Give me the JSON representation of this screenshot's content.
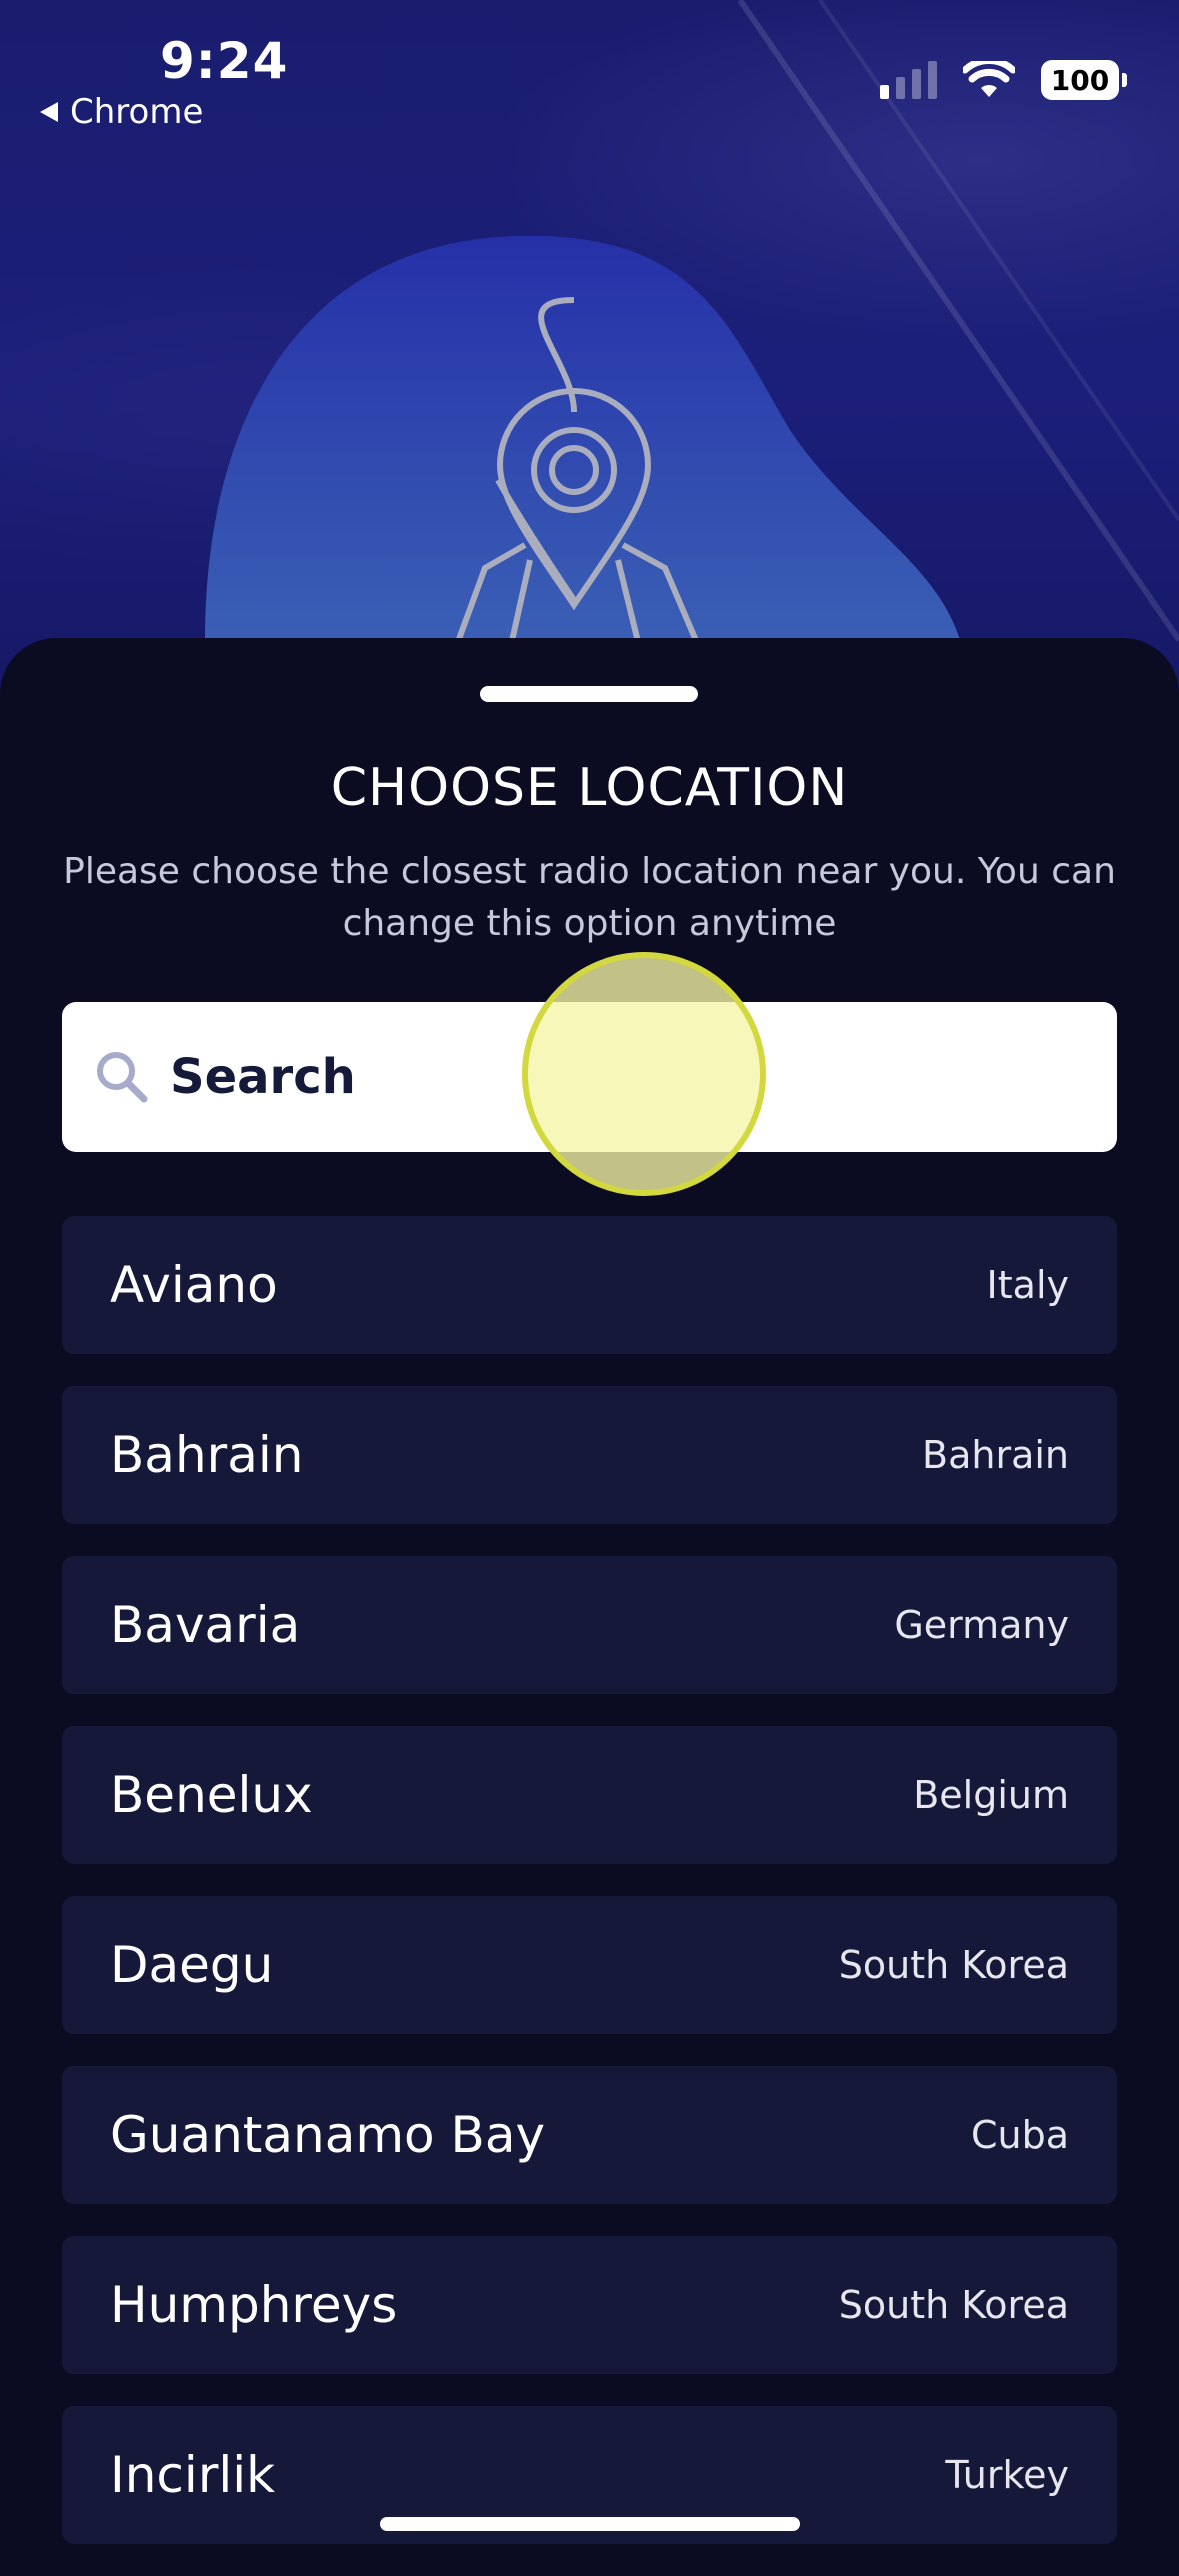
{
  "status_bar": {
    "time": "9:24",
    "back_label": "Chrome",
    "battery": "100"
  },
  "sheet": {
    "title": "CHOOSE LOCATION",
    "subtitle": "Please choose the closest radio location near you. You can change this option anytime",
    "search": {
      "placeholder": "Search",
      "value": ""
    }
  },
  "locations": [
    {
      "city": "Aviano",
      "country": "Italy"
    },
    {
      "city": "Bahrain",
      "country": "Bahrain"
    },
    {
      "city": "Bavaria",
      "country": "Germany"
    },
    {
      "city": "Benelux",
      "country": "Belgium"
    },
    {
      "city": "Daegu",
      "country": "South Korea"
    },
    {
      "city": "Guantanamo Bay",
      "country": "Cuba"
    },
    {
      "city": "Humphreys",
      "country": "South Korea"
    },
    {
      "city": "Incirlik",
      "country": "Turkey"
    }
  ],
  "icons": [
    "location-pin-map-icon",
    "search-icon",
    "back-arrow-icon",
    "signal-icon",
    "wifi-icon",
    "battery-icon"
  ],
  "colors": {
    "hero": "#1c1f7a",
    "sheet": "#0b0c22",
    "row": "#161839",
    "search_bg": "#ffffff",
    "touch_ring": "#d3d83e"
  }
}
